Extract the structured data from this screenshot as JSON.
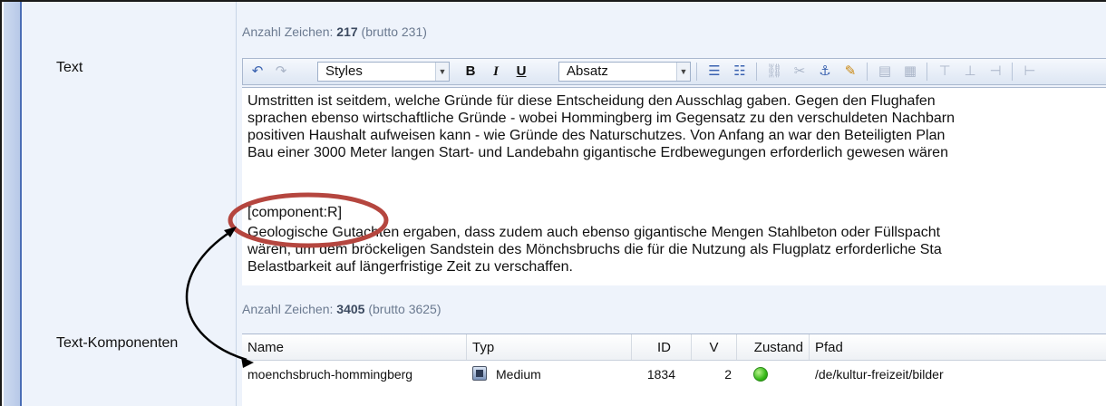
{
  "labels": {
    "text": "Text",
    "text_components": "Text-Komponenten"
  },
  "text_count": {
    "prefix": "Anzahl Zeichen: ",
    "value": "217",
    "suffix": " (brutto 231)"
  },
  "toolbar": {
    "styles_value": "Styles",
    "format_value": "Absatz",
    "bold_label": "B",
    "italic_label": "I",
    "underline_label": "U"
  },
  "editor": {
    "lines_1": [
      "Umstritten ist seitdem, welche Gründe für diese Entscheidung den Ausschlag gaben. Gegen den Flughafen",
      "sprachen ebenso wirtschaftliche Gründe - wobei Hommingberg im Gegensatz zu den verschuldeten Nachbarn",
      "positiven Haushalt aufweisen kann - wie Gründe des Naturschutzes. Von Anfang an war den Beteiligten Plan",
      "Bau einer 3000 Meter langen Start- und Landebahn gigantische Erdbewegungen erforderlich gewesen wären"
    ],
    "component_tag": "[component:R]",
    "lines_2": [
      "Geologische Gutachten ergaben, dass zudem auch ebenso gigantische Mengen Stahlbeton oder Füllspacht",
      "wären, um dem bröckeligen Sandstein des Mönchsbruchs die für die Nutzung als Flugplatz erforderliche Sta",
      "Belastbarkeit auf längerfristige Zeit zu verschaffen."
    ]
  },
  "components_count": {
    "prefix": "Anzahl Zeichen: ",
    "value": "3405",
    "suffix": " (brutto 3625)"
  },
  "table": {
    "headers": {
      "name": "Name",
      "type": "Typ",
      "id": "ID",
      "version": "V",
      "state": "Zustand",
      "path": "Pfad"
    },
    "rows": [
      {
        "name": "moenchsbruch-hommingberg",
        "type": "Medium",
        "type_icon": "image-icon",
        "id": "1834",
        "version": "2",
        "state_color": "#36b818",
        "path": "/de/kultur-freizeit/bilder"
      }
    ]
  },
  "colors": {
    "annotation_ellipse": "#b5463f",
    "accent_blue": "#3a62b0"
  }
}
